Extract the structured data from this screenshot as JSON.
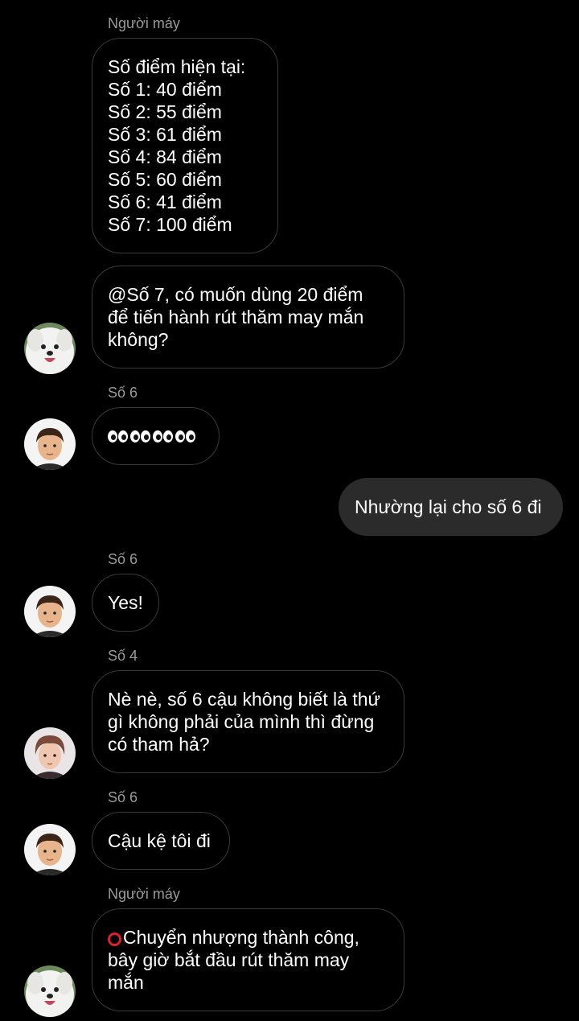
{
  "messages": [
    {
      "sender": "Người máy",
      "text": "Số điểm hiện tại:\nSố 1: 40 điểm\nSố 2: 55 điểm\nSố 3: 61 điểm\nSố 4: 84 điểm\nSố 5: 60 điểm\nSố 6: 41 điểm\nSố 7: 100 điểm"
    },
    {
      "text": "@Số 7, có muốn dùng 20 điểm\nđể tiến hành rút thăm may mắn\nkhông?",
      "avatar": "dog-avatar"
    },
    {
      "sender": "Số 6",
      "content": "eyes-emoji",
      "count": 4,
      "avatar": "boy-avatar"
    },
    {
      "text": "Nhường lại cho số 6 đi",
      "outgoing": true
    },
    {
      "sender": "Số 6",
      "text": "Yes!",
      "avatar": "boy-avatar"
    },
    {
      "sender": "Số 4",
      "text": "Nè nè, số 6 cậu không biết là thứ\ngì không phải của mình thì đừng\ncó tham hả?",
      "avatar": "boy2-avatar"
    },
    {
      "sender": "Số 6",
      "text": "Cậu kệ tôi đi",
      "avatar": "boy-avatar"
    },
    {
      "sender": "Người máy",
      "icon": "red-circle-icon",
      "text": "Chuyển nhượng thành công,\nbây giờ bắt đầu rút thăm may\nmắn",
      "avatar": "dog-avatar"
    }
  ],
  "colors": {
    "background": "#000000",
    "bubble_border": "#3a3a3a",
    "outgoing_bubble": "#2b2b2b",
    "sender_label": "#9a9a9a",
    "status_red": "#e0202a"
  }
}
